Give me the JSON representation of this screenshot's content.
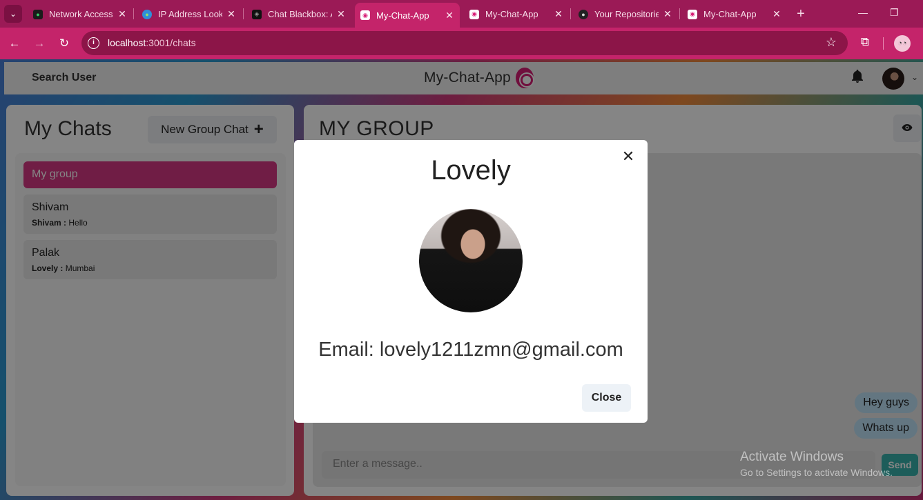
{
  "browser": {
    "tabs": [
      {
        "title": "Network Access",
        "active": false
      },
      {
        "title": "IP Address Looku",
        "active": false
      },
      {
        "title": "Chat Blackbox: A",
        "active": false
      },
      {
        "title": "My-Chat-App",
        "active": true
      },
      {
        "title": "My-Chat-App",
        "active": false
      },
      {
        "title": "Your Repositorie",
        "active": false
      },
      {
        "title": "My-Chat-App",
        "active": false
      }
    ],
    "url_host": "localhost",
    "url_path": ":3001/chats"
  },
  "header": {
    "search_label": "Search User",
    "app_title": "My-Chat-App"
  },
  "sidebar": {
    "title": "My Chats",
    "new_group_label": "New Group Chat",
    "chats": [
      {
        "name": "My group",
        "sender": "",
        "message": "",
        "active": true
      },
      {
        "name": "Shivam",
        "sender": "Shivam :",
        "message": "Hello",
        "active": false
      },
      {
        "name": "Palak",
        "sender": "Lovely :",
        "message": "Mumbai",
        "active": false
      }
    ]
  },
  "chat": {
    "title": "MY GROUP",
    "messages": [
      "Hey guys",
      "Whats up"
    ],
    "input_placeholder": "Enter a message..",
    "send_label": "Send"
  },
  "modal": {
    "title": "Lovely",
    "email": "Email: lovely1211zmn@gmail.com",
    "close_label": "Close"
  },
  "watermark": {
    "line1": "Activate Windows",
    "line2": "Go to Settings to activate Windows."
  },
  "colors": {
    "brand": "#c4246a",
    "active_chat": "#d63884",
    "bubble": "#bee3f8",
    "send": "#38b2ac"
  }
}
